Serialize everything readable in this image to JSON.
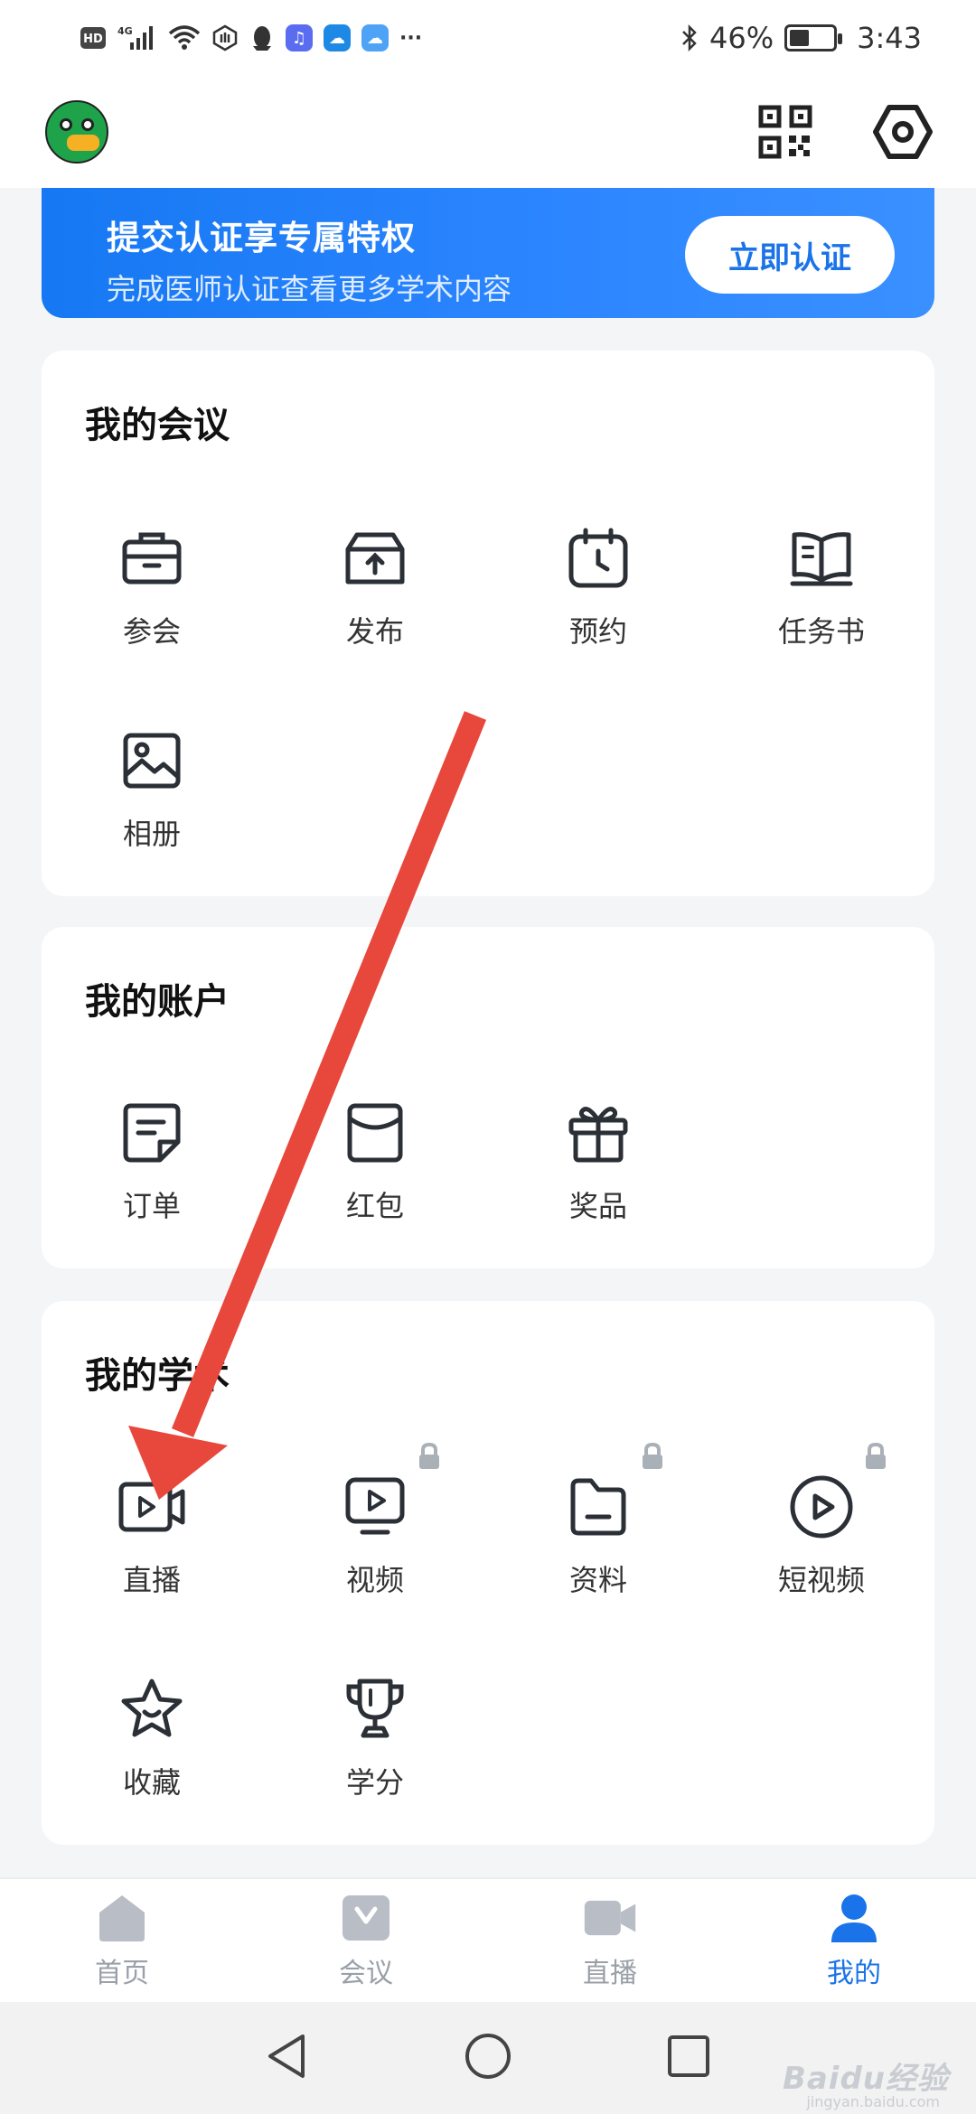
{
  "status_bar": {
    "network": "4G",
    "battery_percent": "46%",
    "battery_level": 0.46,
    "time": "3:43",
    "hd": "HD",
    "more": "···"
  },
  "header": {
    "avatar": "duck-avatar"
  },
  "banner": {
    "title": "提交认证享专属特权",
    "subtitle": "完成医师认证查看更多学术内容",
    "button": "立即认证"
  },
  "meetings": {
    "title": "我的会议",
    "items": [
      {
        "label": "参会",
        "icon": "briefcase-icon"
      },
      {
        "label": "发布",
        "icon": "upload-box-icon"
      },
      {
        "label": "预约",
        "icon": "calendar-clock-icon"
      },
      {
        "label": "任务书",
        "icon": "open-book-icon"
      },
      {
        "label": "相册",
        "icon": "image-icon"
      }
    ]
  },
  "account": {
    "title": "我的账户",
    "items": [
      {
        "label": "订单",
        "icon": "order-note-icon"
      },
      {
        "label": "红包",
        "icon": "red-envelope-icon"
      },
      {
        "label": "奖品",
        "icon": "gift-icon"
      }
    ]
  },
  "academic": {
    "title": "我的学术",
    "items": [
      {
        "label": "直播",
        "icon": "live-camera-icon",
        "locked": false
      },
      {
        "label": "视频",
        "icon": "video-monitor-icon",
        "locked": true
      },
      {
        "label": "资料",
        "icon": "folder-icon",
        "locked": true
      },
      {
        "label": "短视频",
        "icon": "play-circle-icon",
        "locked": true
      },
      {
        "label": "收藏",
        "icon": "star-icon",
        "locked": false
      },
      {
        "label": "学分",
        "icon": "trophy-icon",
        "locked": false
      }
    ]
  },
  "bottom_nav": {
    "items": [
      {
        "label": "首页",
        "icon": "home-icon",
        "active": false
      },
      {
        "label": "会议",
        "icon": "meeting-icon",
        "active": false
      },
      {
        "label": "直播",
        "icon": "live-icon",
        "active": false
      },
      {
        "label": "我的",
        "icon": "profile-icon",
        "active": true
      }
    ]
  },
  "watermark": {
    "text": "Baidu经验",
    "sub": "jingyan.baidu.com"
  },
  "colors": {
    "accent": "#1a73e8",
    "banner": "#2d86ff",
    "annotation_arrow": "#e8473b",
    "icon_stroke": "#2b2f36"
  }
}
